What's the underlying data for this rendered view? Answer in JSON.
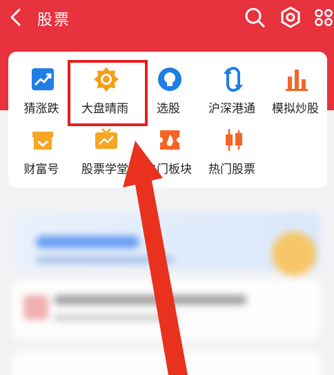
{
  "header": {
    "back_icon": "chevron-left-icon",
    "title": "股票",
    "actions": [
      "search-icon",
      "gear-icon",
      "scan-icon"
    ]
  },
  "grid": {
    "items": [
      {
        "label": "猜涨跌",
        "icon": "trend-up-icon",
        "color": "#1f7ee8"
      },
      {
        "label": "大盘晴雨",
        "icon": "sun-icon",
        "color": "#f4a019"
      },
      {
        "label": "选股",
        "icon": "lightbulb-icon",
        "color": "#1f7ee8"
      },
      {
        "label": "沪深港通",
        "icon": "cycle-icon",
        "color": "#1f7ee8"
      },
      {
        "label": "模拟炒股",
        "icon": "bar-chart-icon",
        "color": "#f56424"
      },
      {
        "label": "财富号",
        "icon": "shop-icon",
        "color": "#f5a623"
      },
      {
        "label": "股票学堂",
        "icon": "tv-icon",
        "color": "#f5a623"
      },
      {
        "label": "热门板块",
        "icon": "flame-ticket-icon",
        "color": "#f56424"
      },
      {
        "label": "热门股票",
        "icon": "candlestick-icon",
        "color": "#f56424"
      }
    ]
  },
  "colors": {
    "brand_red": "#e8323e",
    "highlight_red": "#e31e1e"
  }
}
